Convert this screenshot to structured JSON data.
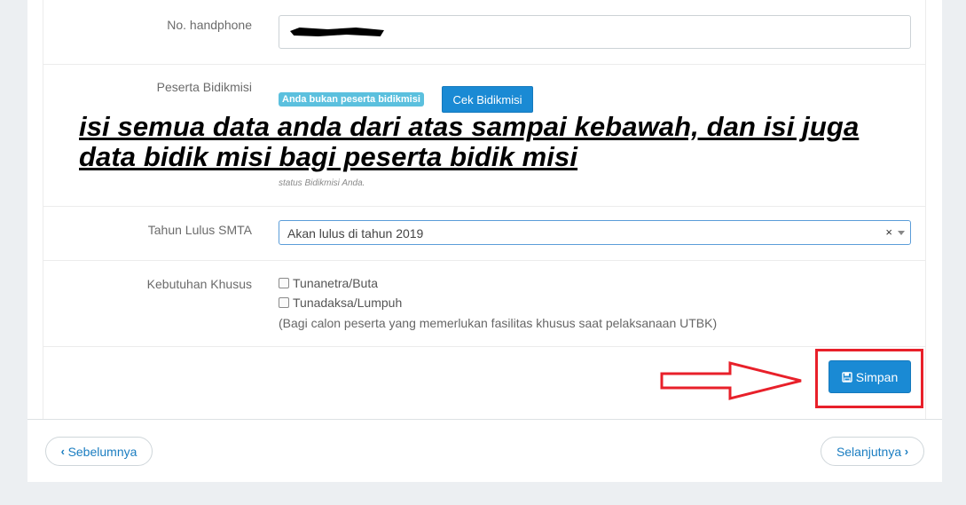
{
  "form": {
    "phone": {
      "label": "No. handphone",
      "value": ""
    },
    "bidikmisi": {
      "label": "Peserta Bidikmisi",
      "status_badge": "Anda bukan peserta bidikmisi",
      "check_button": "Cek Bidikmisi",
      "help_text": "status Bidikmisi Anda."
    },
    "graduation_year": {
      "label": "Tahun Lulus SMTA",
      "selected": "Akan lulus di tahun 2019",
      "clear": "×"
    },
    "special_needs": {
      "label": "Kebutuhan Khusus",
      "options": [
        "Tunanetra/Buta",
        "Tunadaksa/Lumpuh"
      ],
      "note": "(Bagi calon peserta yang memerlukan fasilitas khusus saat pelaksanaan UTBK)"
    },
    "save_button": "Simpan"
  },
  "annotation": {
    "text": "isi semua data anda dari atas sampai kebawah, dan isi juga\ndata bidik misi bagi peserta bidik misi",
    "highlight_color": "#e8202a"
  },
  "navigation": {
    "prev": "Sebelumnya",
    "next": "Selanjutnya"
  },
  "colors": {
    "accent": "#1a8ad4",
    "badge": "#5bc0de",
    "background": "#eceff2"
  },
  "icons": {
    "save": "floppy-disk-icon",
    "prev": "chevron-left-icon",
    "next": "chevron-right-icon"
  }
}
